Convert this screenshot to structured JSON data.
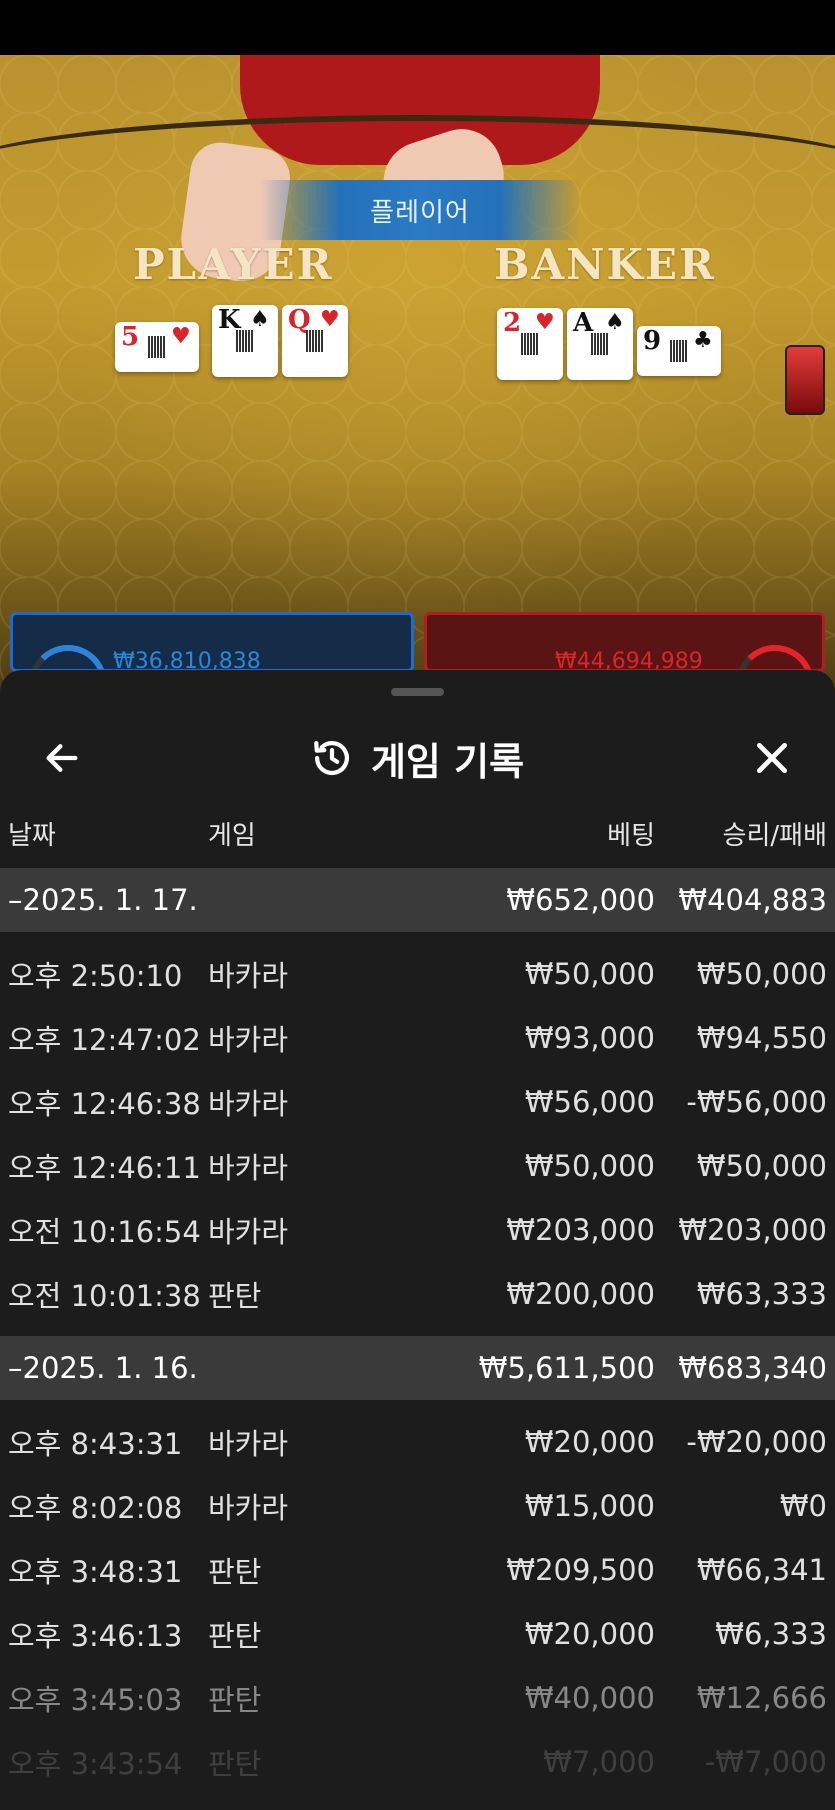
{
  "live_view": {
    "winner_banner": "플레이어",
    "player_label": "PLAYER",
    "banker_label": "BANKER",
    "player_cards": [
      {
        "rank": "5",
        "suit": "♥",
        "color": "red"
      },
      {
        "rank": "K",
        "suit": "♠",
        "color": "black"
      },
      {
        "rank": "Q",
        "suit": "♥",
        "color": "red"
      }
    ],
    "banker_cards": [
      {
        "rank": "2",
        "suit": "♥",
        "color": "red"
      },
      {
        "rank": "A",
        "suit": "♠",
        "color": "black"
      },
      {
        "rank": "9",
        "suit": "♣",
        "color": "black"
      }
    ],
    "player_bet_total": "₩36,810,838",
    "banker_bet_total": "₩44,694,989"
  },
  "sheet": {
    "title": "게임 기록",
    "title_icon": "history-icon",
    "back_icon": "arrow-left-icon",
    "close_icon": "close-icon"
  },
  "columns": {
    "date": "날짜",
    "game": "게임",
    "bet": "베팅",
    "result": "승리/패배"
  },
  "groups": [
    {
      "date": "–2025. 1. 17.",
      "bet_total": "₩652,000",
      "result_total": "₩404,883",
      "rows": [
        {
          "time": "오후 2:50:10",
          "game": "바카라",
          "bet": "₩50,000",
          "result": "₩50,000"
        },
        {
          "time": "오후 12:47:02",
          "game": "바카라",
          "bet": "₩93,000",
          "result": "₩94,550"
        },
        {
          "time": "오후 12:46:38",
          "game": "바카라",
          "bet": "₩56,000",
          "result": "-₩56,000"
        },
        {
          "time": "오후 12:46:11",
          "game": "바카라",
          "bet": "₩50,000",
          "result": "₩50,000"
        },
        {
          "time": "오전 10:16:54",
          "game": "바카라",
          "bet": "₩203,000",
          "result": "₩203,000"
        },
        {
          "time": "오전 10:01:38",
          "game": "판탄",
          "bet": "₩200,000",
          "result": "₩63,333"
        }
      ]
    },
    {
      "date": "–2025. 1. 16.",
      "bet_total": "₩5,611,500",
      "result_total": "₩683,340",
      "rows": [
        {
          "time": "오후 8:43:31",
          "game": "바카라",
          "bet": "₩20,000",
          "result": "-₩20,000"
        },
        {
          "time": "오후 8:02:08",
          "game": "바카라",
          "bet": "₩15,000",
          "result": "₩0"
        },
        {
          "time": "오후 3:48:31",
          "game": "판탄",
          "bet": "₩209,500",
          "result": "₩66,341"
        },
        {
          "time": "오후 3:46:13",
          "game": "판탄",
          "bet": "₩20,000",
          "result": "₩6,333"
        },
        {
          "time": "오후 3:45:03",
          "game": "판탄",
          "bet": "₩40,000",
          "result": "₩12,666"
        },
        {
          "time": "오후 3:43:54",
          "game": "판탄",
          "bet": "₩7,000",
          "result": "-₩7,000"
        }
      ]
    }
  ]
}
